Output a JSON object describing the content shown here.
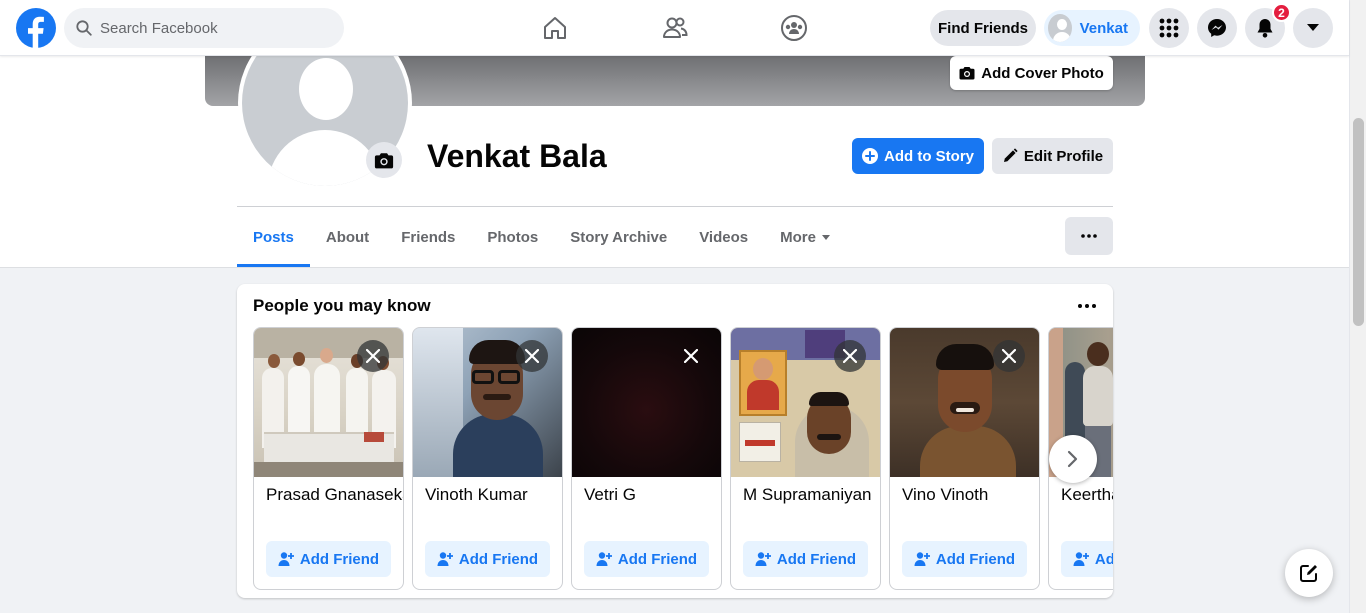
{
  "topbar": {
    "search_placeholder": "Search Facebook",
    "find_friends": "Find Friends",
    "profile_name": "Venkat",
    "notifications_count": "2",
    "icons": [
      "facebook-logo-icon",
      "search-icon",
      "home-icon",
      "friends-icon",
      "groups-icon",
      "menu-grid-icon",
      "messenger-icon",
      "bell-icon",
      "caret-down-icon"
    ]
  },
  "profile": {
    "add_cover_photo": "Add Cover Photo",
    "name": "Venkat Bala",
    "add_to_story": "Add to Story",
    "edit_profile": "Edit Profile"
  },
  "tabs": [
    {
      "label": "Posts",
      "active": true
    },
    {
      "label": "About"
    },
    {
      "label": "Friends"
    },
    {
      "label": "Photos"
    },
    {
      "label": "Story Archive"
    },
    {
      "label": "Videos"
    },
    {
      "label": "More"
    }
  ],
  "pymk": {
    "title": "People you may know",
    "add_friend_label": "Add Friend",
    "people": [
      {
        "name": "Prasad Gnanasekaran"
      },
      {
        "name": "Vinoth Kumar"
      },
      {
        "name": "Vetri G"
      },
      {
        "name": "M Supramaniyan"
      },
      {
        "name": "Vino Vinoth"
      },
      {
        "name": "Keerthana"
      }
    ]
  },
  "colors": {
    "brand": "#1877f2",
    "badge": "#e41e3f",
    "page_bg": "#f0f2f5"
  }
}
